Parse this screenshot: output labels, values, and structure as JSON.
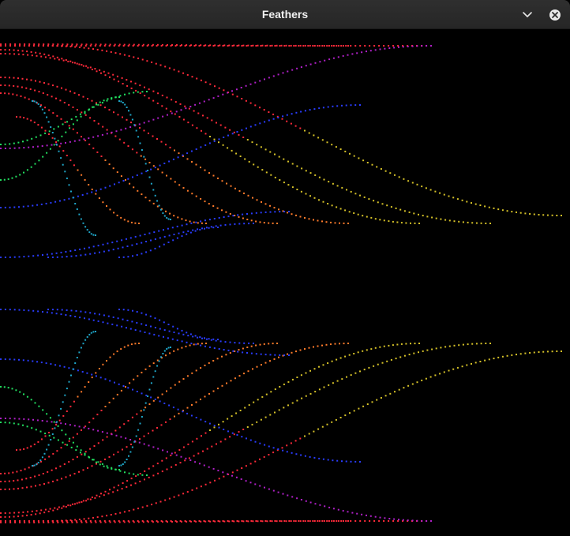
{
  "window": {
    "title": "Feathers",
    "controls": [
      {
        "name": "minimize-button",
        "icon": "chevron-down-icon"
      },
      {
        "name": "close-button",
        "icon": "close-icon"
      }
    ]
  },
  "canvas": {
    "background": "#000000",
    "colors": {
      "red": "#ff2a3a",
      "orange": "#ff7a2a",
      "yellow": "#d6c228",
      "purple": "#b020c8",
      "blue": "#2a3cff",
      "cyan": "#1fa6c8",
      "green": "#22e060"
    }
  }
}
